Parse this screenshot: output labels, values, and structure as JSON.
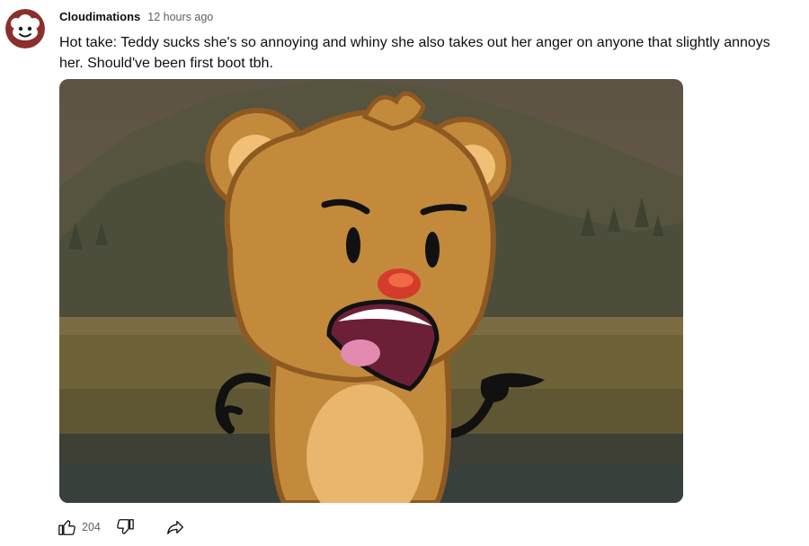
{
  "comment": {
    "author": "Cloudimations",
    "timestamp": "12 hours ago",
    "text": "Hot take: Teddy sucks she's so annoying and whiny she also takes out her anger on anyone that slightly annoys her. Should've been first boot tbh.",
    "like_count": "204",
    "image_alt": "Teddy the bear yelling and pointing"
  },
  "icons": {
    "like": "thumbs-up-icon",
    "dislike": "thumbs-down-icon",
    "share": "share-arrow-icon"
  },
  "colors": {
    "avatar_bg": "#8b2f2a",
    "meta_gray": "#606060",
    "text": "#0f0f0f"
  }
}
